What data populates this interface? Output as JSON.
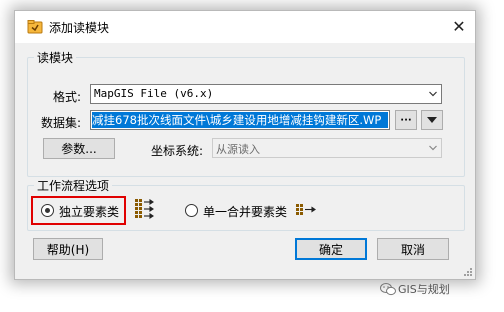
{
  "window": {
    "title": "添加读模块",
    "close_glyph": "✕"
  },
  "reader_group": {
    "legend": "读模块",
    "format_label": "格式:",
    "format_value": "MapGIS File (v6.x)",
    "dataset_label": "数据集:",
    "dataset_value": "减挂678批次线面文件\\城乡建设用地增减挂钩建新区.WP",
    "browse_button": "···",
    "parameters_button": "参数...",
    "coordsys_label": "坐标系统:",
    "coordsys_value": "从源读入"
  },
  "workflow_group": {
    "legend": "工作流程选项",
    "option_individual": "独立要素类",
    "option_individual_selected": true,
    "option_single_merged": "单一合并要素类",
    "option_single_merged_selected": false
  },
  "footer": {
    "help_button": "帮助(H)",
    "ok_button": "确定",
    "cancel_button": "取消"
  },
  "watermark": {
    "text": "GIS与规划"
  },
  "colors": {
    "selection": "#0078d7",
    "highlight_box": "#e00000"
  }
}
